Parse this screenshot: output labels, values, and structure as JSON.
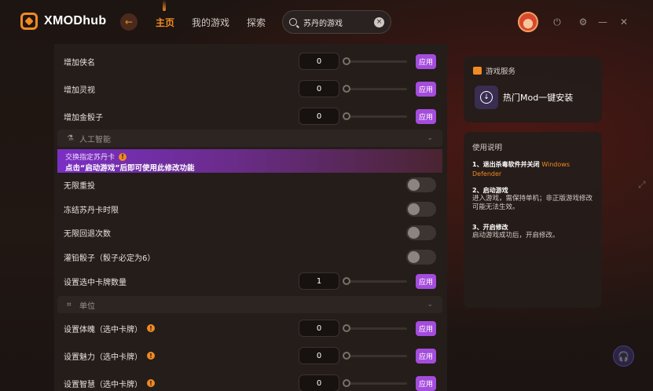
{
  "app": {
    "logo_text": "XMODhub"
  },
  "header": {
    "back_glyph": "←",
    "nav": [
      "主页",
      "我的游戏",
      "探索"
    ],
    "search_value": "苏丹的游戏",
    "clear_glyph": "×",
    "icons": [
      "avatar",
      "power-icon",
      "settings-icon",
      "minimize-icon",
      "close-icon"
    ]
  },
  "top_rows": [
    {
      "label": "增加侠名",
      "value": "0",
      "apply": "应用"
    },
    {
      "label": "增加灵视",
      "value": "0",
      "apply": "应用"
    },
    {
      "label": "增加金骰子",
      "value": "0",
      "apply": "应用"
    }
  ],
  "section_ai": {
    "icon": "robot-icon",
    "title": "人工智能",
    "chevron": "⌄"
  },
  "banner": {
    "title": "交换指定苏丹卡",
    "info_glyph": "!",
    "subtitle": "点击“启动游戏”后即可使用此修改功能"
  },
  "toggle_rows": [
    {
      "label": "无限重投"
    },
    {
      "label": "冻结苏丹卡时限"
    },
    {
      "label": "无限回退次数"
    },
    {
      "label": "灌铅骰子（骰子必定为6）"
    }
  ],
  "card_count_row": {
    "label": "设置选中卡牌数量",
    "value": "1",
    "apply": "应用"
  },
  "section_unit": {
    "icon": "unit-icon",
    "title": "单位",
    "chevron": "⌄"
  },
  "unit_rows": [
    {
      "label": "设置体魄（选中卡牌）",
      "value": "0",
      "apply": "应用"
    },
    {
      "label": "设置魅力（选中卡牌）",
      "value": "0",
      "apply": "应用"
    },
    {
      "label": "设置智慧（选中卡牌）",
      "value": "0",
      "apply": "应用"
    }
  ],
  "service_card": {
    "title": "游戏服务",
    "item_label": "热门Mod一键安装"
  },
  "guide_card": {
    "title": "使用说明",
    "step1_head": "1、退出杀毒软件并关闭",
    "step1_highlight": "Windows Defender",
    "step2_head": "2、启动游戏",
    "step2_body": "进入游戏，需保持单机；非正版游戏修改可能无法生效。",
    "step3_head": "3、开启修改",
    "step3_body": "启动游戏成功后，开启修改。"
  },
  "colors": {
    "accent": "#f08a23",
    "apply_purple": "#a44cdc",
    "panel": "#241d1a"
  }
}
